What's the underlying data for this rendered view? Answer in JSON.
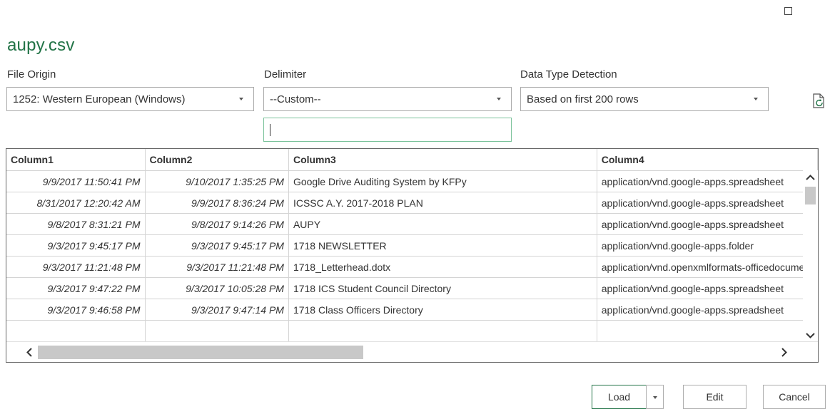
{
  "dialog": {
    "title": "aupy.csv"
  },
  "options": {
    "file_origin": {
      "label": "File Origin",
      "value": "1252: Western European (Windows)"
    },
    "delimiter": {
      "label": "Delimiter",
      "value": "--Custom--",
      "custom_value": ""
    },
    "detection": {
      "label": "Data Type Detection",
      "value": "Based on first 200 rows"
    }
  },
  "table": {
    "columns": [
      "Column1",
      "Column2",
      "Column3",
      "Column4"
    ],
    "rows": [
      [
        "9/9/2017 11:50:41 PM",
        "9/10/2017 1:35:25 PM",
        "Google Drive Auditing System by KFPy",
        "application/vnd.google-apps.spreadsheet"
      ],
      [
        "8/31/2017 12:20:42 AM",
        "9/9/2017 8:36:24 PM",
        "ICSSC A.Y. 2017-2018 PLAN",
        "application/vnd.google-apps.spreadsheet"
      ],
      [
        "9/8/2017 8:31:21 PM",
        "9/8/2017 9:14:26 PM",
        "AUPY",
        "application/vnd.google-apps.spreadsheet"
      ],
      [
        "9/3/2017 9:45:17 PM",
        "9/3/2017 9:45:17 PM",
        "1718 NEWSLETTER",
        "application/vnd.google-apps.folder"
      ],
      [
        "9/3/2017 11:21:48 PM",
        "9/3/2017 11:21:48 PM",
        "1718_Letterhead.dotx",
        "application/vnd.openxmlformats-officedocument"
      ],
      [
        "9/3/2017 9:47:22 PM",
        "9/3/2017 10:05:28 PM",
        "1718 ICS Student Council Directory",
        "application/vnd.google-apps.spreadsheet"
      ],
      [
        "9/3/2017 9:46:58 PM",
        "9/3/2017 9:47:14 PM",
        "1718 Class Officers Directory",
        "application/vnd.google-apps.spreadsheet"
      ],
      [
        "",
        "",
        "",
        ""
      ]
    ]
  },
  "buttons": {
    "load": "Load",
    "edit": "Edit",
    "cancel": "Cancel"
  },
  "colors": {
    "accent": "#217346",
    "input_focus": "#7ac29a"
  },
  "icons": {
    "refresh": "refresh-preview-icon",
    "maximize": "maximize-icon"
  }
}
